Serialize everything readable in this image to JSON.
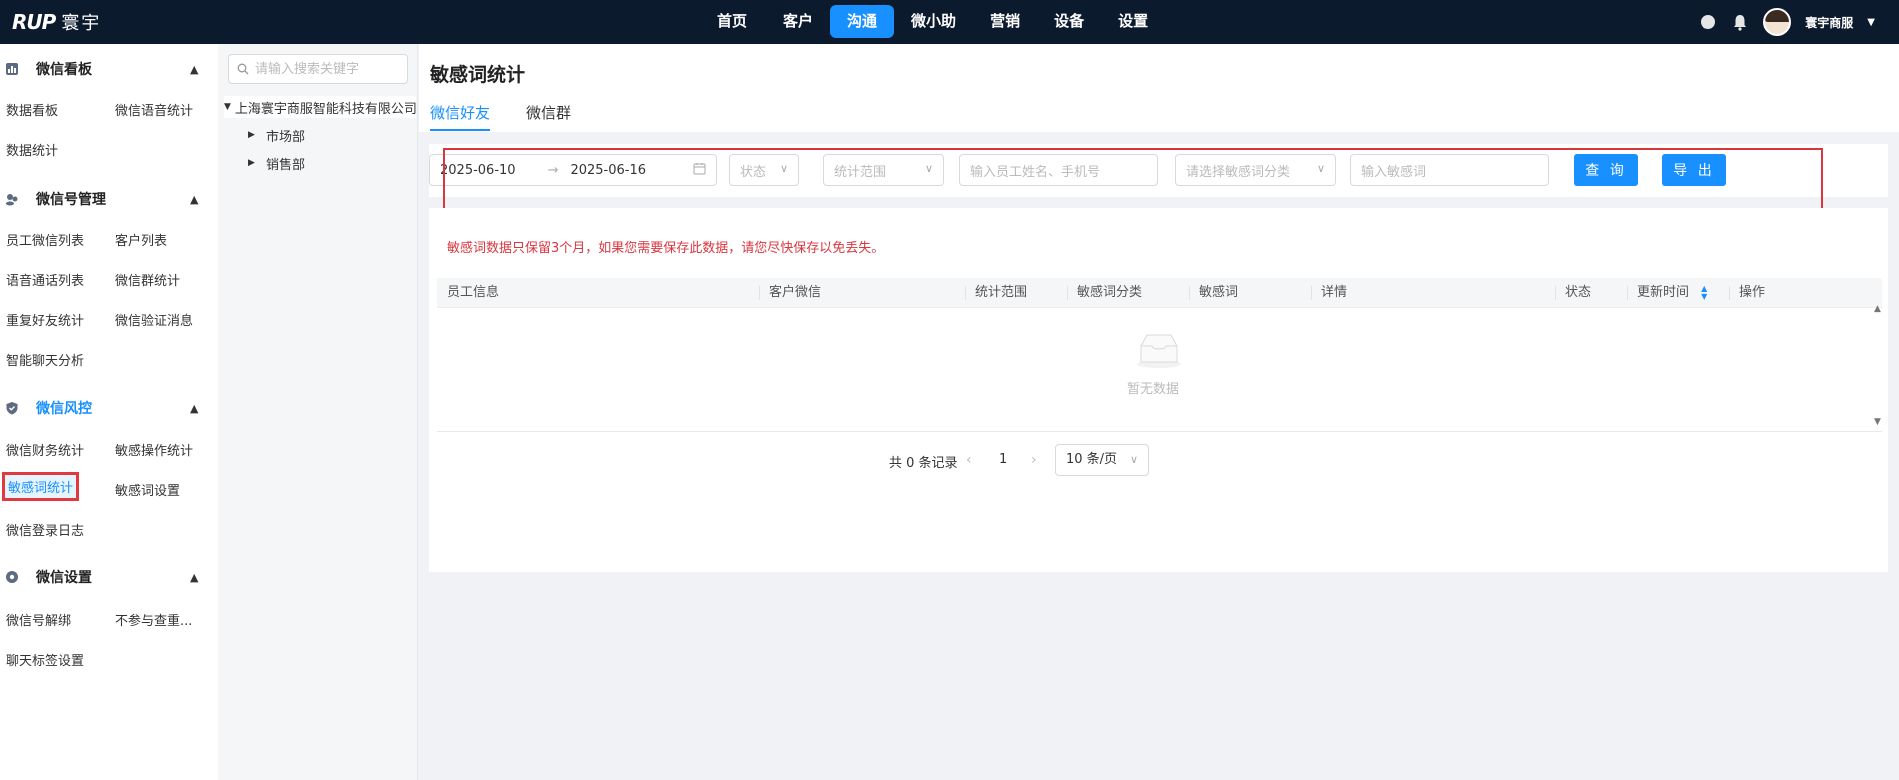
{
  "brand": {
    "mark": "RUP",
    "name": "寰宇"
  },
  "nav": {
    "items": [
      "首页",
      "客户",
      "沟通",
      "微小助",
      "营销",
      "设备",
      "设置"
    ],
    "active": "沟通"
  },
  "user": {
    "name": "寰宇商服"
  },
  "sidebar": {
    "sections": [
      {
        "title": "微信看板",
        "items": [
          "数据看板",
          "微信语音统计",
          "数据统计"
        ]
      },
      {
        "title": "微信号管理",
        "items": [
          "员工微信列表",
          "客户列表",
          "语音通话列表",
          "微信群统计",
          "重复好友统计",
          "微信验证消息",
          "智能聊天分析"
        ]
      },
      {
        "title": "微信风控",
        "items": [
          "微信财务统计",
          "敏感操作统计",
          "敏感词统计",
          "敏感词设置",
          "微信登录日志"
        ]
      },
      {
        "title": "微信设置",
        "items": [
          "微信号解绑",
          "不参与查重...",
          "聊天标签设置"
        ]
      }
    ],
    "active_item": "敏感词统计"
  },
  "tree": {
    "search_placeholder": "请输入搜索关键字",
    "root": "上海寰宇商服智能科技有限公司",
    "children": [
      "市场部",
      "销售部"
    ]
  },
  "page": {
    "title": "敏感词统计",
    "tabs": [
      "微信好友",
      "微信群"
    ],
    "active_tab": "微信好友"
  },
  "filters": {
    "date_start": "2025-06-10",
    "date_end": "2025-06-16",
    "status_placeholder": "状态",
    "scope_placeholder": "统计范围",
    "employee_placeholder": "输入员工姓名、手机号",
    "category_placeholder": "请选择敏感词分类",
    "word_placeholder": "输入敏感词",
    "query_label": "查 询",
    "export_label": "导 出"
  },
  "notice": "敏感词数据只保留3个月，如果您需要保存此数据，请您尽快保存以免丢失。",
  "table": {
    "columns": [
      "员工信息",
      "客户微信",
      "统计范围",
      "敏感词分类",
      "敏感词",
      "详情",
      "状态",
      "更新时间",
      "操作"
    ],
    "rows": [],
    "empty_text": "暂无数据"
  },
  "pagination": {
    "total_text": "共 0 条记录",
    "current_page": "1",
    "page_size": "10 条/页"
  }
}
